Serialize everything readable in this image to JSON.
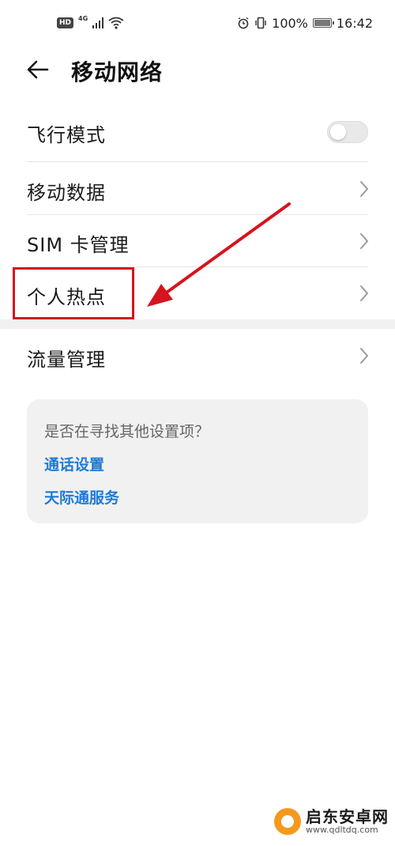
{
  "status_bar": {
    "hd": "HD",
    "network": "4G",
    "battery": "100%",
    "time": "16:42"
  },
  "header": {
    "title": "移动网络"
  },
  "rows": [
    {
      "label": "飞行模式",
      "control": "toggle",
      "toggle_on": false
    },
    {
      "label": "移动数据",
      "control": "chevron"
    },
    {
      "label": "SIM 卡管理",
      "control": "chevron"
    },
    {
      "label": "个人热点",
      "control": "chevron"
    },
    {
      "label": "流量管理",
      "control": "chevron"
    }
  ],
  "suggestions": {
    "question": "是否在寻找其他设置项？",
    "links": [
      "通话设置",
      "天际通服务"
    ]
  },
  "watermark": {
    "text": "启东安卓网",
    "url": "www.qdltdq.com"
  },
  "colors": {
    "link": "#1e7ad6",
    "annotation": "#d4141e",
    "card_bg": "#f1f1f1"
  }
}
